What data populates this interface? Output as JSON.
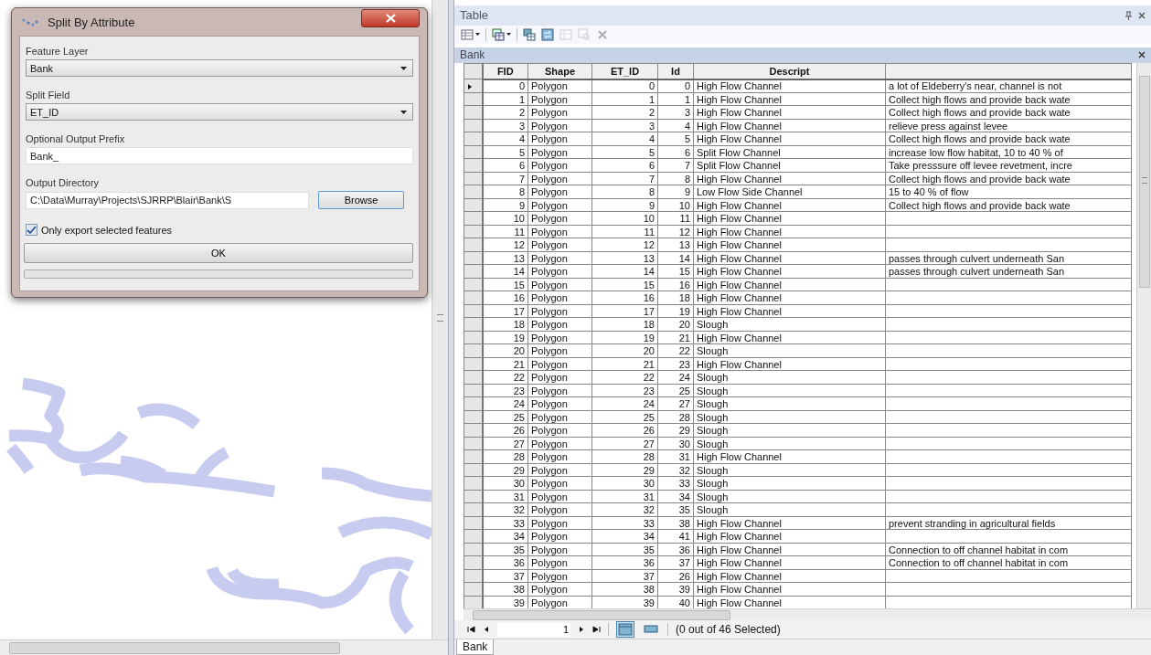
{
  "dialog": {
    "title": "Split By Attribute",
    "fields": [
      {
        "kind": "dropdown",
        "label": "Feature Layer",
        "value": "Bank"
      },
      {
        "kind": "dropdown",
        "label": "Split Field",
        "value": "ET_ID"
      },
      {
        "kind": "text",
        "label": "Optional Output Prefix",
        "value": "Bank_"
      },
      {
        "kind": "browse",
        "label": "Output Directory",
        "value": "C:\\Data\\Murray\\Projects\\SJRRP\\Blair\\Bank\\S",
        "button": "Browse"
      }
    ],
    "only_selected": {
      "label": "Only export selected features",
      "checked": true
    },
    "ok_button": "OK",
    "progress": {
      "level": 0
    }
  },
  "table_window": {
    "title": "Table",
    "toolbar": [
      {
        "kind": "table-options",
        "menu": true,
        "disabled": false
      },
      {
        "kind": "related-tables",
        "menu": true,
        "disabled": false
      },
      {
        "kind": "select-by-attributes",
        "menu": false,
        "disabled": false
      },
      {
        "kind": "switch-selection",
        "menu": false,
        "disabled": false
      },
      {
        "kind": "clear-selection",
        "menu": false,
        "disabled": true
      },
      {
        "kind": "zoom-selected",
        "menu": false,
        "disabled": true
      },
      {
        "kind": "delete-selected",
        "menu": false,
        "disabled": true
      }
    ],
    "layer_title": "Bank",
    "table": {
      "columns": [
        {
          "label": "FID",
          "kind": "number"
        },
        {
          "label": "Shape",
          "kind": "text"
        },
        {
          "label": "ET_ID",
          "kind": "number"
        },
        {
          "label": "Id",
          "kind": "number"
        },
        {
          "label": "Descript",
          "kind": "text"
        },
        {
          "kind": "text"
        }
      ],
      "rows": [
        {
          "current": true,
          "cells": [
            "0",
            "Polygon",
            "0",
            "0",
            "High Flow Channel",
            "a lot of Eldeberry's near, channel is not"
          ]
        },
        {
          "current": false,
          "cells": [
            "1",
            "Polygon",
            "1",
            "1",
            "High Flow Channel",
            "Collect high flows and provide back wate"
          ]
        },
        {
          "current": false,
          "cells": [
            "2",
            "Polygon",
            "2",
            "3",
            "High Flow Channel",
            "Collect high flows and provide back wate"
          ]
        },
        {
          "current": false,
          "cells": [
            "3",
            "Polygon",
            "3",
            "4",
            "High Flow Channel",
            "relieve press against levee"
          ]
        },
        {
          "current": false,
          "cells": [
            "4",
            "Polygon",
            "4",
            "5",
            "High Flow Channel",
            "Collect high flows and provide back wate"
          ]
        },
        {
          "current": false,
          "cells": [
            "5",
            "Polygon",
            "5",
            "6",
            "Split Flow Channel",
            "increase low flow habitat, 10 to 40 % of"
          ]
        },
        {
          "current": false,
          "cells": [
            "6",
            "Polygon",
            "6",
            "7",
            "Split Flow Channel",
            "Take presssure off levee revetment, incre"
          ]
        },
        {
          "current": false,
          "cells": [
            "7",
            "Polygon",
            "7",
            "8",
            "High Flow Channel",
            "Collect high flows and provide back wate"
          ]
        },
        {
          "current": false,
          "cells": [
            "8",
            "Polygon",
            "8",
            "9",
            "Low Flow Side Channel",
            "15 to 40 % of flow"
          ]
        },
        {
          "current": false,
          "cells": [
            "9",
            "Polygon",
            "9",
            "10",
            "High Flow Channel",
            "Collect high flows and provide back wate"
          ]
        },
        {
          "current": false,
          "cells": [
            "10",
            "Polygon",
            "10",
            "11",
            "High Flow Channel"
          ]
        },
        {
          "current": false,
          "cells": [
            "11",
            "Polygon",
            "11",
            "12",
            "High Flow Channel"
          ]
        },
        {
          "current": false,
          "cells": [
            "12",
            "Polygon",
            "12",
            "13",
            "High Flow Channel"
          ]
        },
        {
          "current": false,
          "cells": [
            "13",
            "Polygon",
            "13",
            "14",
            "High Flow Channel",
            "passes through culvert underneath San"
          ]
        },
        {
          "current": false,
          "cells": [
            "14",
            "Polygon",
            "14",
            "15",
            "High Flow Channel",
            "passes through culvert underneath San"
          ]
        },
        {
          "current": false,
          "cells": [
            "15",
            "Polygon",
            "15",
            "16",
            "High Flow Channel"
          ]
        },
        {
          "current": false,
          "cells": [
            "16",
            "Polygon",
            "16",
            "18",
            "High Flow Channel"
          ]
        },
        {
          "current": false,
          "cells": [
            "17",
            "Polygon",
            "17",
            "19",
            "High Flow Channel"
          ]
        },
        {
          "current": false,
          "cells": [
            "18",
            "Polygon",
            "18",
            "20",
            "Slough"
          ]
        },
        {
          "current": false,
          "cells": [
            "19",
            "Polygon",
            "19",
            "21",
            "High Flow Channel"
          ]
        },
        {
          "current": false,
          "cells": [
            "20",
            "Polygon",
            "20",
            "22",
            "Slough"
          ]
        },
        {
          "current": false,
          "cells": [
            "21",
            "Polygon",
            "21",
            "23",
            "High Flow Channel"
          ]
        },
        {
          "current": false,
          "cells": [
            "22",
            "Polygon",
            "22",
            "24",
            "Slough"
          ]
        },
        {
          "current": false,
          "cells": [
            "23",
            "Polygon",
            "23",
            "25",
            "Slough"
          ]
        },
        {
          "current": false,
          "cells": [
            "24",
            "Polygon",
            "24",
            "27",
            "Slough"
          ]
        },
        {
          "current": false,
          "cells": [
            "25",
            "Polygon",
            "25",
            "28",
            "Slough"
          ]
        },
        {
          "current": false,
          "cells": [
            "26",
            "Polygon",
            "26",
            "29",
            "Slough"
          ]
        },
        {
          "current": false,
          "cells": [
            "27",
            "Polygon",
            "27",
            "30",
            "Slough"
          ]
        },
        {
          "current": false,
          "cells": [
            "28",
            "Polygon",
            "28",
            "31",
            "High Flow Channel"
          ]
        },
        {
          "current": false,
          "cells": [
            "29",
            "Polygon",
            "29",
            "32",
            "Slough"
          ]
        },
        {
          "current": false,
          "cells": [
            "30",
            "Polygon",
            "30",
            "33",
            "Slough"
          ]
        },
        {
          "current": false,
          "cells": [
            "31",
            "Polygon",
            "31",
            "34",
            "Slough"
          ]
        },
        {
          "current": false,
          "cells": [
            "32",
            "Polygon",
            "32",
            "35",
            "Slough"
          ]
        },
        {
          "current": false,
          "cells": [
            "33",
            "Polygon",
            "33",
            "38",
            "High Flow Channel",
            "prevent stranding in agricultural fields"
          ]
        },
        {
          "current": false,
          "cells": [
            "34",
            "Polygon",
            "34",
            "41",
            "High Flow Channel"
          ]
        },
        {
          "current": false,
          "cells": [
            "35",
            "Polygon",
            "35",
            "36",
            "High Flow Channel",
            "Connection to off channel habitat in com"
          ]
        },
        {
          "current": false,
          "cells": [
            "36",
            "Polygon",
            "36",
            "37",
            "High Flow Channel",
            "Connection to off channel habitat in com"
          ]
        },
        {
          "current": false,
          "cells": [
            "37",
            "Polygon",
            "37",
            "26",
            "High Flow Channel"
          ]
        },
        {
          "current": false,
          "cells": [
            "38",
            "Polygon",
            "38",
            "39",
            "High Flow Channel"
          ]
        },
        {
          "current": false,
          "cells": [
            "39",
            "Polygon",
            "39",
            "40",
            "High Flow Channel"
          ]
        }
      ]
    },
    "navigator": {
      "record": "1",
      "views": [
        {
          "kind": "all",
          "selected": true
        },
        {
          "kind": "selected",
          "selected": false
        }
      ],
      "status": "(0 out of 46 Selected)"
    },
    "tabs": [
      {
        "label": "Bank",
        "selected": true
      }
    ]
  }
}
